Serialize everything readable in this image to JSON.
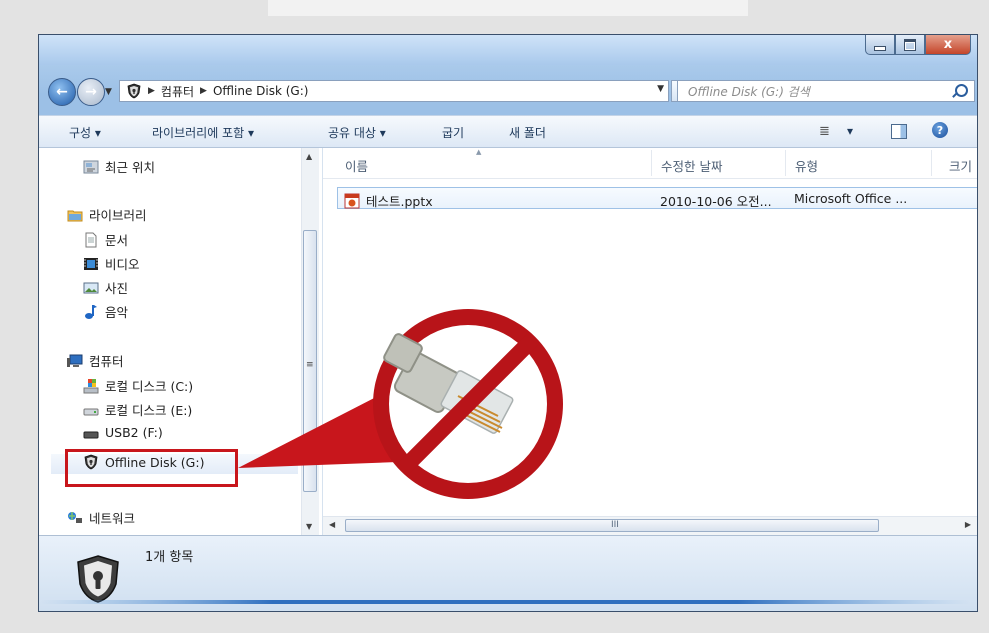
{
  "address": {
    "crumbs": [
      "컴퓨터",
      "Offline Disk (G:)"
    ],
    "search_placeholder": "Offline Disk (G:) 검색"
  },
  "window_buttons": {
    "close_label": "x"
  },
  "toolbar": {
    "organize": "구성 ▾",
    "include_in_library": "라이브러리에 포함 ▾",
    "share_with": "공유 대상 ▾",
    "burn": "굽기",
    "new_folder": "새 폴더",
    "views_label": "▾"
  },
  "navpane": {
    "recent": "최근 위치",
    "libraries": "라이브러리",
    "documents": "문서",
    "videos": "비디오",
    "pictures": "사진",
    "music": "음악",
    "computer": "컴퓨터",
    "local_c": "로컬 디스크 (C:)",
    "local_e": "로컬 디스크 (E:)",
    "usb2": "USB2 (F:)",
    "offline_disk": "Offline Disk (G:)",
    "network": "네트워크"
  },
  "columns": {
    "name": "이름",
    "modified": "수정한 날짜",
    "type": "유형",
    "size": "크기"
  },
  "files": [
    {
      "name": "테스트.pptx",
      "modified": "2010-10-06 오전...",
      "type": "Microsoft Office ..."
    }
  ],
  "status": {
    "count": "1개 항목"
  },
  "colors": {
    "highlight": "#c8161c",
    "window_frame": "#9cc0e6",
    "accent": "#2b5e9e"
  },
  "icons": {
    "shield": "shield-lock-icon",
    "network_cable": "network-cable-icon",
    "prohibited": "prohibited-icon"
  }
}
